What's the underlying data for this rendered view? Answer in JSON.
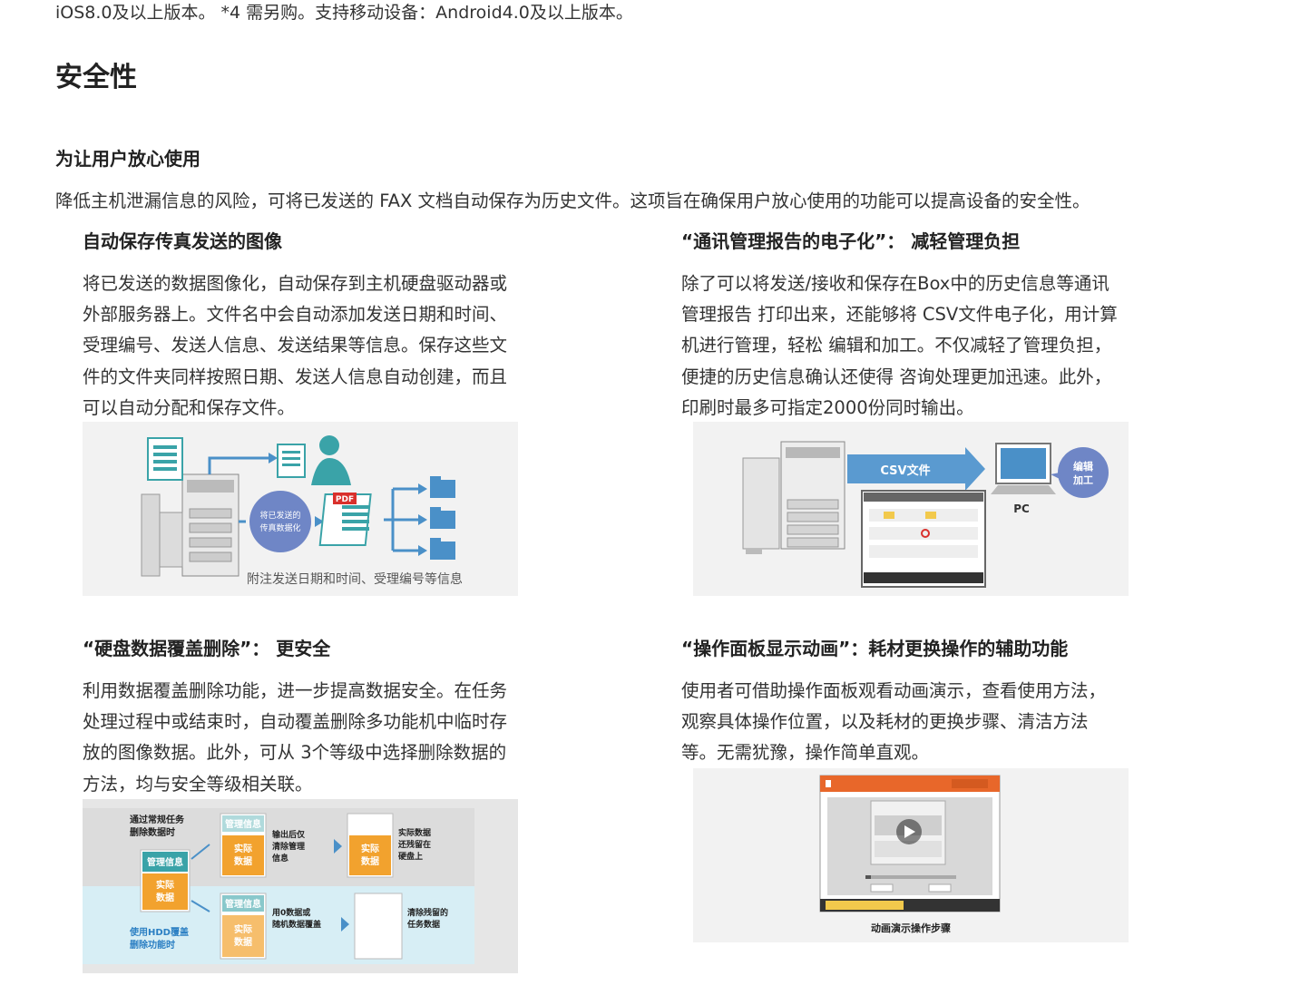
{
  "top_text": "iOS8.0及以上版本。 *4 需另购。支持移动设备：Android4.0及以上版本。",
  "section_title": "安全性",
  "sub_title": "为让用户放心使用",
  "intro": "降低主机泄漏信息的风险，可将已发送的 FAX 文档自动保存为历史文件。这项旨在确保用户放心使用的功能可以提高设备的安全性。",
  "features": [
    {
      "title": "自动保存传真发送的图像",
      "lines": [
        "将已发送的数据图像化，自动保存到主机硬盘驱动器或",
        "外部服务器上。文件名中会自动添加发送日期和时间、",
        "受理编号、发送人信息、发送结果等信息。保存这些文",
        "件的文件夹同样按照日期、发送人信息自动创建，而且",
        "可以自动分配和保存文件。"
      ],
      "figure": {
        "pdf_label": "PDF",
        "circle_line1": "将已发送的",
        "circle_line2": "传真数据化",
        "caption": "附注发送日期和时间、受理编号等信息"
      }
    },
    {
      "title": "“通讯管理报告的电子化”： 减轻管理负担",
      "lines": [
        "除了可以将发送/接收和保存在Box中的历史信息等通讯",
        "管理报告 打印出来，还能够将 CSV文件电子化，用计算",
        "机进行管理，轻松 编辑和加工。不仅减轻了管理负担，",
        "便捷的历史信息确认还使得 咨询处理更加迅速。此外，",
        "印刷时最多可指定2000份同时输出。"
      ],
      "figure": {
        "arrow_label": "CSV文件",
        "pc_label": "PC",
        "bubble_line1": "编辑",
        "bubble_line2": "加工"
      }
    },
    {
      "title": "“硬盘数据覆盖删除”： 更安全",
      "lines": [
        "利用数据覆盖删除功能，进一步提高数据安全。在任务",
        "处理过程中或结束时，自动覆盖删除多功能机中临时存",
        "放的图像数据。此外，可从 3个等级中选择删除数据的",
        "方法，均与安全等级相关联。"
      ],
      "figure": {
        "normal_label_1": "通过常规任务",
        "normal_label_2": "删除数据时",
        "hdd_label_1": "使用HDD覆盖",
        "hdd_label_2": "删除功能时",
        "mgmt_info": "管理信息",
        "actual_data_1": "实际",
        "actual_data_2": "数据",
        "top_desc_1": "输出后仅",
        "top_desc_2": "清除管理",
        "top_desc_3": "信息",
        "top_result_1": "实际数据",
        "top_result_2": "还残留在",
        "top_result_3": "硬盘上",
        "bottom_desc_1": "用0数据或",
        "bottom_desc_2": "随机数据覆盖",
        "bottom_result_1": "清除残留的",
        "bottom_result_2": "任务数据"
      }
    },
    {
      "title": "“操作面板显示动画”：耗材更换操作的辅助功能",
      "lines": [
        "使用者可借助操作面板观看动画演示，查看使用方法，",
        "观察具体操作位置，以及耗材的更换步骤、清洁方法",
        "等。无需犹豫，操作简单直观。"
      ],
      "figure": {
        "caption": "动画演示操作步骤"
      }
    }
  ],
  "colors": {
    "text": "#333333",
    "heading": "#222222",
    "fig_blue": "#4a90c8",
    "fig_teal": "#3aa3a8",
    "fig_orange": "#f2a22e",
    "fig_circle": "#6f86c6",
    "pdf_red": "#d9302c",
    "panel_orange": "#e8672a"
  },
  "icons": [
    "document-icon",
    "printer-icon",
    "person-icon",
    "folder-icon",
    "pdf-icon",
    "pc-icon",
    "play-icon",
    "arrow-icon"
  ]
}
